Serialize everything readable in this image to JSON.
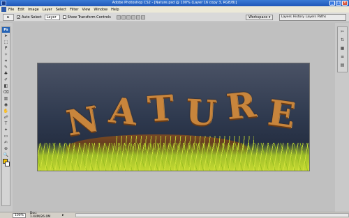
{
  "window": {
    "title": "Adobe Photoshop CS2 - [Nature.psd @ 100% (Layer 16 copy 3, RGB/8)]",
    "minimize_label": "_",
    "maximize_label": "□",
    "close_label": "×"
  },
  "menu": {
    "items": [
      "File",
      "Edit",
      "Image",
      "Layer",
      "Select",
      "Filter",
      "View",
      "Window",
      "Help"
    ]
  },
  "options": {
    "tool_glyph": "▸",
    "auto_select_label": "Auto Select",
    "auto_select_checked": "✓",
    "layer_select_value": "Layer",
    "show_transform_label": "Show Transform Controls",
    "workspace_label": "Workspace ▾",
    "palette_tabs": [
      "Layers",
      "History",
      "Layers",
      "Paths"
    ]
  },
  "toolbox": {
    "badge": "Ps",
    "tools": [
      "➤",
      "⬚",
      "ᑭ",
      "✧",
      "⌗",
      "✎",
      "♣",
      "✐",
      "◧",
      "⌫",
      "▥",
      "◉",
      "✋",
      "☍",
      "T",
      "✦",
      "▭",
      "✍",
      "⊕",
      "🔍"
    ]
  },
  "canvas": {
    "letters": [
      "N",
      "A",
      "T",
      "U",
      "R",
      "E"
    ]
  },
  "rightpanel": {
    "icons": [
      "✂",
      "⇅",
      "▦",
      "≡",
      "▤"
    ]
  },
  "status": {
    "zoom": "100%",
    "doc_info": "Doc: 1.44M/26.0M",
    "arrow": "▸"
  }
}
